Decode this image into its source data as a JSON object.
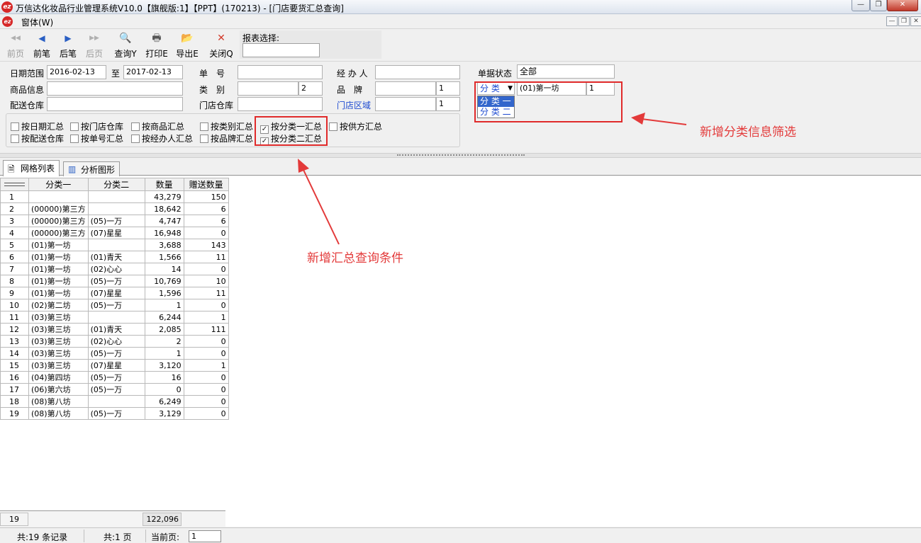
{
  "window": {
    "title": "万信达化妆品行业管理系统V10.0【旗舰版:1】【PPT】(170213) - [门店要货汇总查询]",
    "logo_text": "ez",
    "controls": [
      "—",
      "❐",
      "✕"
    ]
  },
  "menubar": {
    "item": "窗体(W)",
    "mdi_controls": [
      "—",
      "❐",
      "✕"
    ]
  },
  "toolbar": {
    "buttons": [
      {
        "label": "前页",
        "icon": "first-page-icon",
        "glyph": "◀◀",
        "enabled": false
      },
      {
        "label": "前笔",
        "icon": "prev-record-icon",
        "glyph": "◀",
        "enabled": true
      },
      {
        "label": "后笔",
        "icon": "next-record-icon",
        "glyph": "▶",
        "enabled": true
      },
      {
        "label": "后页",
        "icon": "last-page-icon",
        "glyph": "▶▶",
        "enabled": false
      },
      {
        "label": "查询Y",
        "icon": "query-icon",
        "glyph": "🔍",
        "enabled": true
      },
      {
        "label": "打印E",
        "icon": "print-icon",
        "glyph": "🖶",
        "enabled": true
      },
      {
        "label": "导出E",
        "icon": "export-icon",
        "glyph": "📂",
        "enabled": true
      },
      {
        "label": "关闭Q",
        "icon": "close-icon",
        "glyph": "✕",
        "enabled": true
      }
    ],
    "report_select_label": "报表选择:",
    "report_select_value": ""
  },
  "filters": {
    "date_range_label": "日期范围",
    "date_from": "2016-02-13",
    "date_to_label": "至",
    "date_to": "2017-02-13",
    "order_no_label": "单　号",
    "order_no": "",
    "handler_label": "经 办 人",
    "handler": "",
    "doc_status_label": "单据状态",
    "doc_status": "全部",
    "product_info_label": "商品信息",
    "product_info": "",
    "category_label": "类　别",
    "category": "",
    "category_num": "2",
    "brand_label": "品　牌",
    "brand": "",
    "brand_num": "1",
    "classify_select": "分 类",
    "classify_value": "(01)第一坊",
    "classify_num": "1",
    "classify_options": [
      "分 类 一",
      "分 类 二"
    ],
    "dist_warehouse_label": "配送仓库",
    "dist_warehouse": "",
    "store_warehouse_label": "门店仓库",
    "store_warehouse": "",
    "store_area_label": "门店区域",
    "store_area": "",
    "store_area_num": "1"
  },
  "checkboxes": [
    {
      "label": "按日期汇总",
      "checked": false
    },
    {
      "label": "按门店仓库",
      "checked": false
    },
    {
      "label": "按商品汇总",
      "checked": false
    },
    {
      "label": "按类别汇总",
      "checked": false
    },
    {
      "label": "按分类一汇总",
      "checked": true
    },
    {
      "label": "按供方汇总",
      "checked": false
    },
    {
      "label": "按配送仓库",
      "checked": false
    },
    {
      "label": "按单号汇总",
      "checked": false
    },
    {
      "label": "按经办人汇总",
      "checked": false
    },
    {
      "label": "按品牌汇总",
      "checked": false
    },
    {
      "label": "按分类二汇总",
      "checked": true
    }
  ],
  "annotations": {
    "filter_note": "新增分类信息筛选",
    "summary_note": "新增汇总查询条件"
  },
  "tabs": [
    "网格列表",
    "分析图形"
  ],
  "grid": {
    "columns": [
      "",
      "分类一",
      "分类二",
      "数量",
      "赠送数量"
    ],
    "rows": [
      [
        "1",
        "",
        "",
        "43,279",
        "150"
      ],
      [
        "2",
        "(00000)第三方",
        "",
        "18,642",
        "6"
      ],
      [
        "3",
        "(00000)第三方",
        "(05)一万",
        "4,747",
        "6"
      ],
      [
        "4",
        "(00000)第三方",
        "(07)星星",
        "16,948",
        "0"
      ],
      [
        "5",
        "(01)第一坊",
        "",
        "3,688",
        "143"
      ],
      [
        "6",
        "(01)第一坊",
        "(01)青天",
        "1,566",
        "11"
      ],
      [
        "7",
        "(01)第一坊",
        "(02)心心",
        "14",
        "0"
      ],
      [
        "8",
        "(01)第一坊",
        "(05)一万",
        "10,769",
        "10"
      ],
      [
        "9",
        "(01)第一坊",
        "(07)星星",
        "1,596",
        "11"
      ],
      [
        "10",
        "(02)第二坊",
        "(05)一万",
        "1",
        "0"
      ],
      [
        "11",
        "(03)第三坊",
        "",
        "6,244",
        "1"
      ],
      [
        "12",
        "(03)第三坊",
        "(01)青天",
        "2,085",
        "111"
      ],
      [
        "13",
        "(03)第三坊",
        "(02)心心",
        "2",
        "0"
      ],
      [
        "14",
        "(03)第三坊",
        "(05)一万",
        "1",
        "0"
      ],
      [
        "15",
        "(03)第三坊",
        "(07)星星",
        "3,120",
        "1"
      ],
      [
        "16",
        "(04)第四坊",
        "(05)一万",
        "16",
        "0"
      ],
      [
        "17",
        "(06)第六坊",
        "(05)一万",
        "0",
        "0"
      ],
      [
        "18",
        "(08)第八坊",
        "",
        "6,249",
        "0"
      ],
      [
        "19",
        "(08)第八坊",
        "(05)一万",
        "3,129",
        "0"
      ]
    ],
    "footer_count": "19",
    "footer_qty": "122,096"
  },
  "statusbar": {
    "records": "共:19 条记录",
    "pages": "共:1 页",
    "current_page_label": "当前页:",
    "current_page": "1"
  }
}
